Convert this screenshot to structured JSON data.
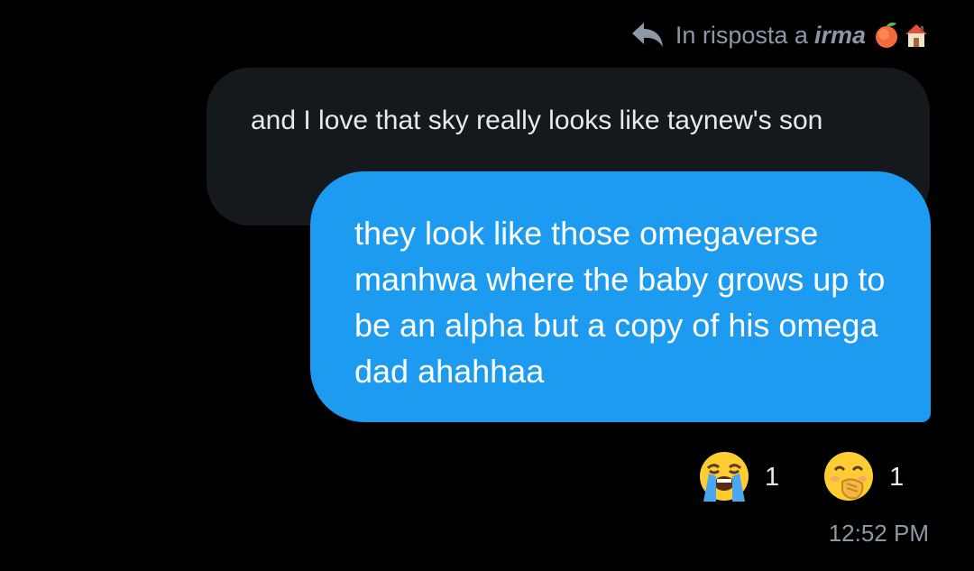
{
  "reply_context": {
    "label": "In risposta a",
    "user": "irma",
    "user_emojis": [
      "peach-emoji",
      "house-emoji"
    ]
  },
  "quoted_message": {
    "text": "and I love that sky really looks like taynew's son"
  },
  "message": {
    "text": "they look like those omegaverse manhwa where the baby grows up to be an alpha but a copy of his omega dad ahahhaa"
  },
  "reactions": [
    {
      "emoji": "loudly-crying-face-emoji",
      "count": "1"
    },
    {
      "emoji": "face-with-hand-over-mouth-emoji",
      "count": "1"
    }
  ],
  "timestamp": "12:52 PM",
  "colors": {
    "background": "#000000",
    "own_bubble": "#1d9bf0",
    "quoted_bubble": "#15181c",
    "secondary_text": "#8b98a5",
    "primary_text": "#e7e9ea"
  }
}
